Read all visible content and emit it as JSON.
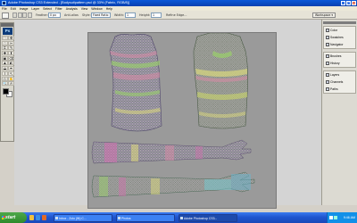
{
  "window": {
    "title": "Adobe Photoshop CS3 Extended - [Bodysuitpattern.psd @ 33% (Fabric, RGB/8)]",
    "minimize_icon": "minimize-icon",
    "maximize_icon": "maximize-icon",
    "close_icon": "close-icon"
  },
  "menu": [
    "File",
    "Edit",
    "Image",
    "Layer",
    "Select",
    "Filter",
    "Analysis",
    "View",
    "Window",
    "Help"
  ],
  "options_bar": {
    "feather_label": "Feather:",
    "feather_value": "0 px",
    "antialias_label": "Anti-alias",
    "style_label": "Style:",
    "style_value": "Fixed Ratio",
    "width_label": "Width:",
    "width_value": "1",
    "height_label": "Height:",
    "height_value": "1",
    "refine_edge_label": "Refine Edge...",
    "workspace_label": "Workspace ▾"
  },
  "toolbox": {
    "logo": "Ps",
    "tools": [
      "⬚",
      "✥",
      "◌",
      "✂",
      "⌗",
      "✎",
      "✚",
      "⬆",
      "▣",
      "⌫",
      "▲",
      "◐",
      "◒",
      "✒",
      "T",
      "↖",
      "◇",
      "✋",
      "🔍",
      "✍"
    ],
    "foreground_color": "#000000",
    "background_color": "#ffffff"
  },
  "panels": {
    "group1": [
      "Color",
      "Swatches",
      "Navigator"
    ],
    "group2": [
      "Brushes",
      "History"
    ],
    "group3": [
      "Layers",
      "Channels",
      "Paths"
    ]
  },
  "taskbar": {
    "start_label": "start",
    "tasks": [
      {
        "label": "Inbox - Zolo (IN) C...",
        "active": false
      },
      {
        "label": "Photos",
        "active": false
      },
      {
        "label": "Adobe Photoshop CS3...",
        "active": true
      }
    ],
    "clock": "9:46 AM"
  }
}
